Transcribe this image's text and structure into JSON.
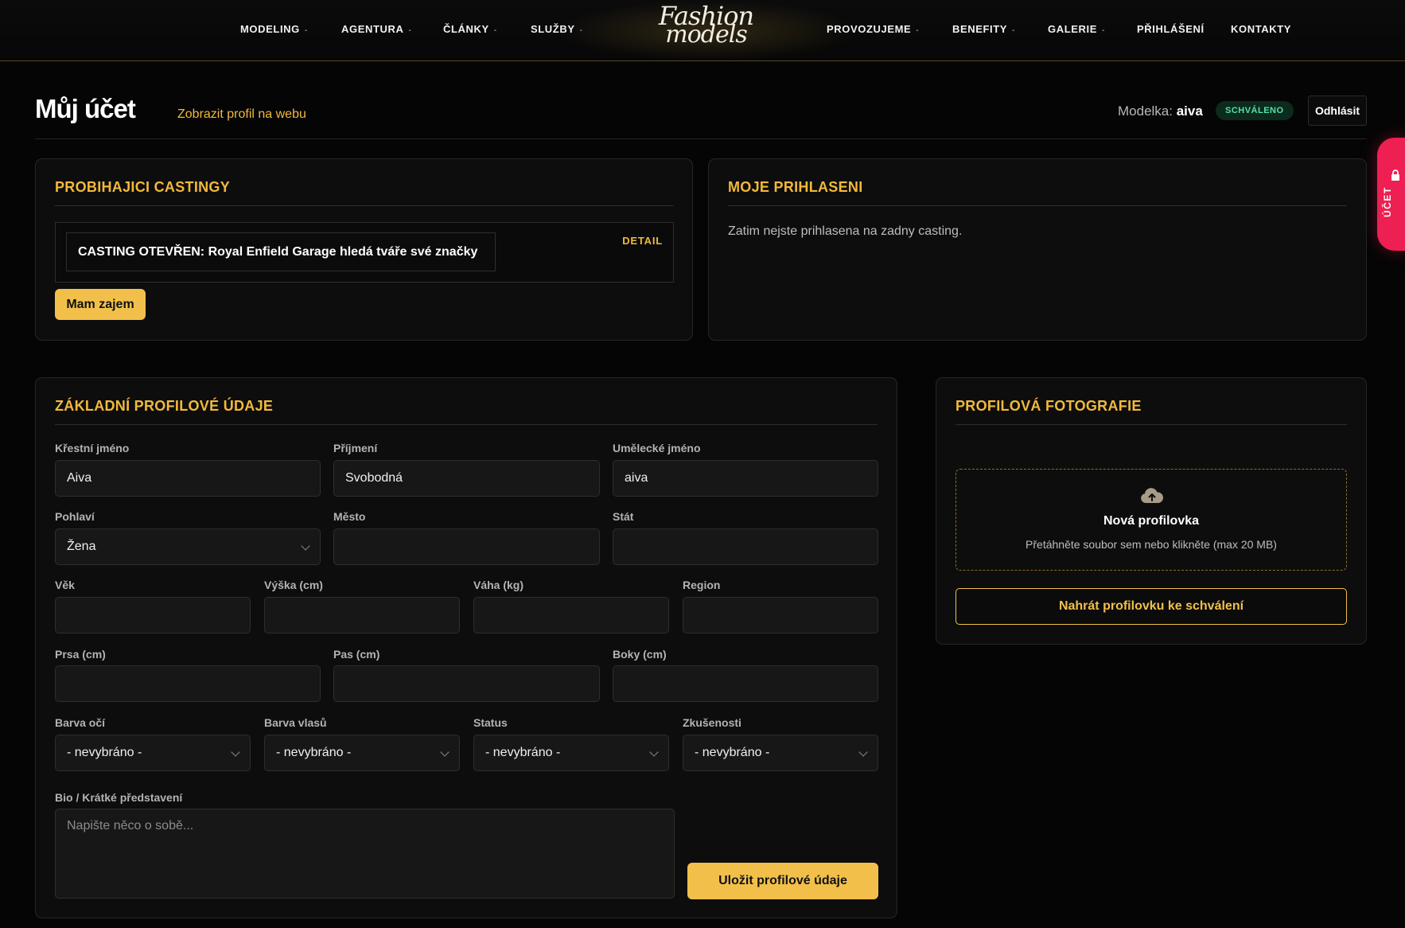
{
  "nav": {
    "left": [
      {
        "label": "MODELING",
        "caret": "-"
      },
      {
        "label": "AGENTURA",
        "caret": "-"
      },
      {
        "label": "ČLÁNKY",
        "caret": "-"
      },
      {
        "label": "SLUŽBY",
        "caret": "-"
      }
    ],
    "right": [
      {
        "label": "PROVOZUJEME",
        "caret": "-"
      },
      {
        "label": "BENEFITY",
        "caret": "-"
      },
      {
        "label": "GALERIE",
        "caret": "-"
      },
      {
        "label": "PŘIHLÁŠENÍ",
        "caret": ""
      },
      {
        "label": "KONTAKTY",
        "caret": ""
      }
    ],
    "logo": {
      "line1": "Fashion",
      "line2": "models"
    }
  },
  "header": {
    "title": "Můj účet",
    "profile_link": "Zobrazit profil na webu",
    "model_prefix": "Modelka:",
    "model_name": "aiva",
    "status_badge": "SCHVÁLENO",
    "logout": "Odhlásit"
  },
  "side_tab": {
    "label": "ÚČET"
  },
  "castings": {
    "title": "PROBIHAJICI CASTINGY",
    "item": "CASTING OTEVŘEN: Royal Enfield Garage hledá tváře své značky",
    "detail": "DETAIL",
    "interest_button": "Mam zajem"
  },
  "my_applications": {
    "title": "MOJE PRIHLASENI",
    "empty": "Zatim nejste prihlasena na zadny casting."
  },
  "profile_form": {
    "title": "ZÁKLADNÍ PROFILOVÉ ÚDAJE",
    "first_name": {
      "label": "Křestní jméno",
      "value": "Aiva"
    },
    "last_name": {
      "label": "Příjmení",
      "value": "Svobodná"
    },
    "stage_name": {
      "label": "Umělecké jméno",
      "value": "aiva"
    },
    "gender": {
      "label": "Pohlaví",
      "value": "Žena"
    },
    "city": {
      "label": "Město",
      "value": ""
    },
    "country": {
      "label": "Stát",
      "value": ""
    },
    "age": {
      "label": "Věk",
      "value": ""
    },
    "height": {
      "label": "Výška (cm)",
      "value": ""
    },
    "weight": {
      "label": "Váha (kg)",
      "value": ""
    },
    "region": {
      "label": "Region",
      "value": ""
    },
    "bust": {
      "label": "Prsa (cm)",
      "value": ""
    },
    "waist": {
      "label": "Pas (cm)",
      "value": ""
    },
    "hips": {
      "label": "Boky (cm)",
      "value": ""
    },
    "eye_color": {
      "label": "Barva očí",
      "value": "- nevybráno -"
    },
    "hair_color": {
      "label": "Barva vlasů",
      "value": "- nevybráno -"
    },
    "status": {
      "label": "Status",
      "value": "- nevybráno -"
    },
    "experience": {
      "label": "Zkušenosti",
      "value": "- nevybráno -"
    },
    "bio": {
      "label": "Bio / Krátké představení",
      "placeholder": "Napište něco o sobě..."
    },
    "save_button": "Uložit profilové údaje"
  },
  "photo": {
    "title": "PROFILOVÁ FOTOGRAFIE",
    "dropzone_icon": "cloud-upload-icon",
    "dropzone_title": "Nová profilovka",
    "dropzone_sub": "Přetáhněte soubor sem nebo klikněte (max 20 MB)",
    "upload_button": "Nahrát profilovku ke schválení"
  },
  "colors": {
    "accent": "#f2c04a",
    "badge_bg": "#0c2a1e",
    "badge_fg": "#54e1a3",
    "side_tab": "#ee1f52"
  }
}
